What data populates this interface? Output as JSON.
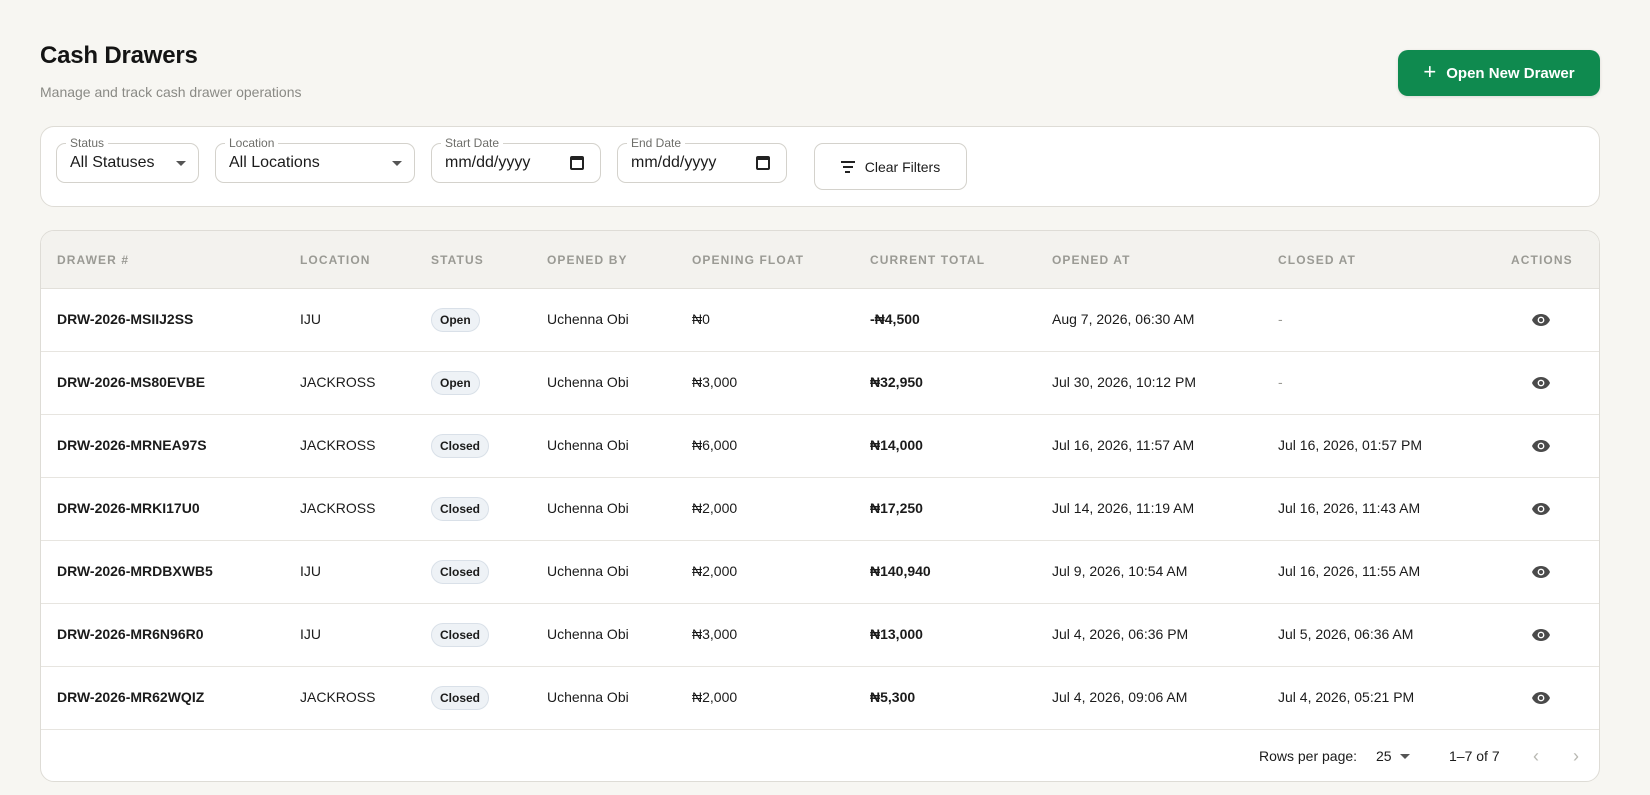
{
  "header": {
    "title": "Cash Drawers",
    "subtitle": "Manage and track cash drawer operations",
    "open_button": "Open New Drawer"
  },
  "filters": {
    "status": {
      "label": "Status",
      "value": "All Statuses"
    },
    "location": {
      "label": "Location",
      "value": "All Locations"
    },
    "start_date": {
      "label": "Start Date",
      "value": "mm/dd/yyyy"
    },
    "end_date": {
      "label": "End Date",
      "value": "mm/dd/yyyy"
    },
    "clear_label": "Clear Filters"
  },
  "table": {
    "columns": [
      "DRAWER #",
      "LOCATION",
      "STATUS",
      "OPENED BY",
      "OPENING FLOAT",
      "CURRENT TOTAL",
      "OPENED AT",
      "CLOSED AT",
      "ACTIONS"
    ],
    "rows": [
      {
        "drawer": "DRW-2026-MSIIJ2SS",
        "location": "IJU",
        "status": "Open",
        "opened_by": "Uchenna Obi",
        "opening_float": "₦0",
        "current_total": "-₦4,500",
        "opened_at": "Aug 7, 2026, 06:30 AM",
        "closed_at": "-"
      },
      {
        "drawer": "DRW-2026-MS80EVBE",
        "location": "JACKROSS",
        "status": "Open",
        "opened_by": "Uchenna Obi",
        "opening_float": "₦3,000",
        "current_total": "₦32,950",
        "opened_at": "Jul 30, 2026, 10:12 PM",
        "closed_at": "-"
      },
      {
        "drawer": "DRW-2026-MRNEA97S",
        "location": "JACKROSS",
        "status": "Closed",
        "opened_by": "Uchenna Obi",
        "opening_float": "₦6,000",
        "current_total": "₦14,000",
        "opened_at": "Jul 16, 2026, 11:57 AM",
        "closed_at": "Jul 16, 2026, 01:57 PM"
      },
      {
        "drawer": "DRW-2026-MRKI17U0",
        "location": "JACKROSS",
        "status": "Closed",
        "opened_by": "Uchenna Obi",
        "opening_float": "₦2,000",
        "current_total": "₦17,250",
        "opened_at": "Jul 14, 2026, 11:19 AM",
        "closed_at": "Jul 16, 2026, 11:43 AM"
      },
      {
        "drawer": "DRW-2026-MRDBXWB5",
        "location": "IJU",
        "status": "Closed",
        "opened_by": "Uchenna Obi",
        "opening_float": "₦2,000",
        "current_total": "₦140,940",
        "opened_at": "Jul 9, 2026, 10:54 AM",
        "closed_at": "Jul 16, 2026, 11:55 AM"
      },
      {
        "drawer": "DRW-2026-MR6N96R0",
        "location": "IJU",
        "status": "Closed",
        "opened_by": "Uchenna Obi",
        "opening_float": "₦3,000",
        "current_total": "₦13,000",
        "opened_at": "Jul 4, 2026, 06:36 PM",
        "closed_at": "Jul 5, 2026, 06:36 AM"
      },
      {
        "drawer": "DRW-2026-MR62WQIZ",
        "location": "JACKROSS",
        "status": "Closed",
        "opened_by": "Uchenna Obi",
        "opening_float": "₦2,000",
        "current_total": "₦5,300",
        "opened_at": "Jul 4, 2026, 09:06 AM",
        "closed_at": "Jul 4, 2026, 05:21 PM"
      }
    ],
    "action_icon": "eye-icon"
  },
  "pagination": {
    "rows_per_page_label": "Rows per page:",
    "rows_per_page": "25",
    "range": "1–7 of 7",
    "prev_icon": "chevron-left-icon",
    "next_icon": "chevron-right-icon"
  },
  "colors": {
    "primary": "#0f8a4f",
    "background": "#f7f6f2",
    "badge_bg": "#eef2f6"
  }
}
